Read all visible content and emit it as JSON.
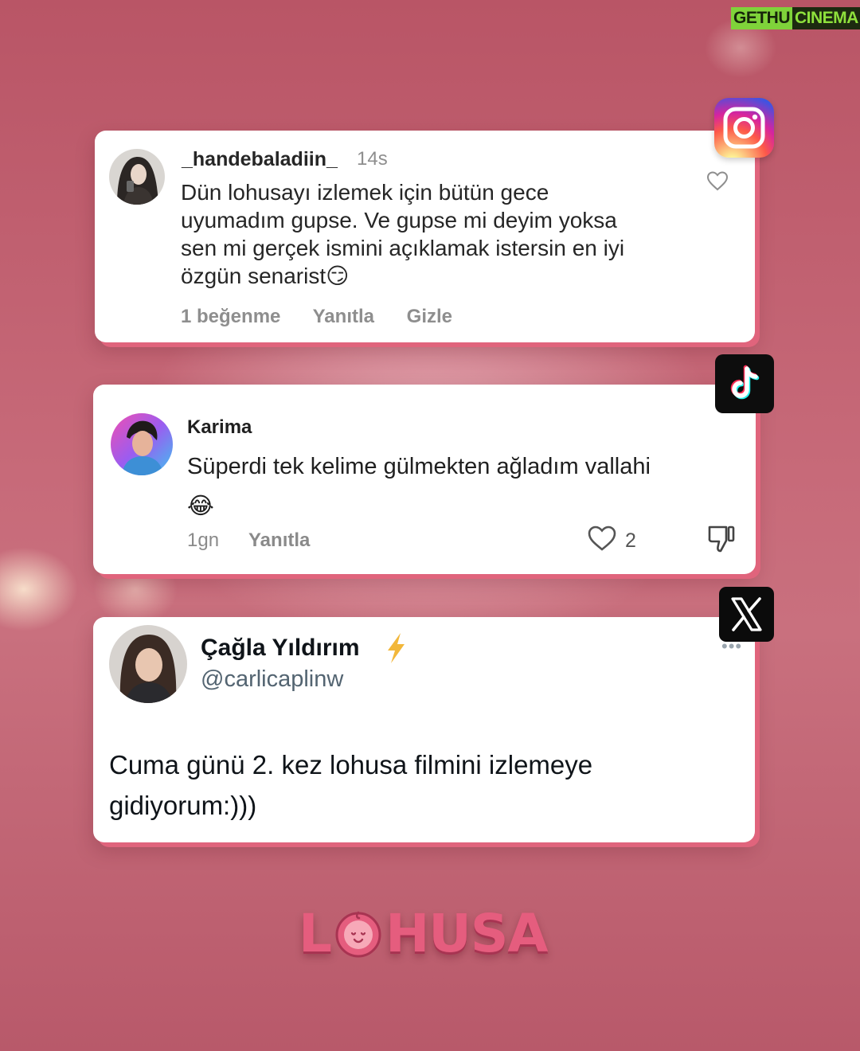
{
  "watermark": {
    "part1": "GETHU",
    "part2": "CINEMA"
  },
  "instagram_comment": {
    "platform_icon": "instagram-icon",
    "username": "_handebaladiin_",
    "time": "14s",
    "text": "Dün lohusayı izlemek için bütün gece uyumadım gupse. Ve gupse mi deyim yoksa sen mi gerçek ismini açıklamak istersin en iyi özgün senarist😏",
    "likes": "1 beğenme",
    "reply": "Yanıtla",
    "hide": "Gizle"
  },
  "tiktok_comment": {
    "platform_icon": "tiktok-icon",
    "username": "Karima",
    "text": "Süperdi tek kelime gülmekten ağladım vallahi 😂",
    "time": "1gn",
    "reply": "Yanıtla",
    "like_count": "2"
  },
  "x_post": {
    "platform_icon": "x-icon",
    "name": "Çağla Yıldırım",
    "handle": "@carlicaplinw",
    "text": "Cuma günü 2. kez lohusa filmini izlemeye gidiyorum:)))",
    "more": "•••"
  },
  "logo": {
    "l": "L",
    "rest": "HUSA"
  },
  "colors": {
    "card_shadow": "#e0647c",
    "logo": "#e55d7e",
    "background": "#c06474"
  }
}
